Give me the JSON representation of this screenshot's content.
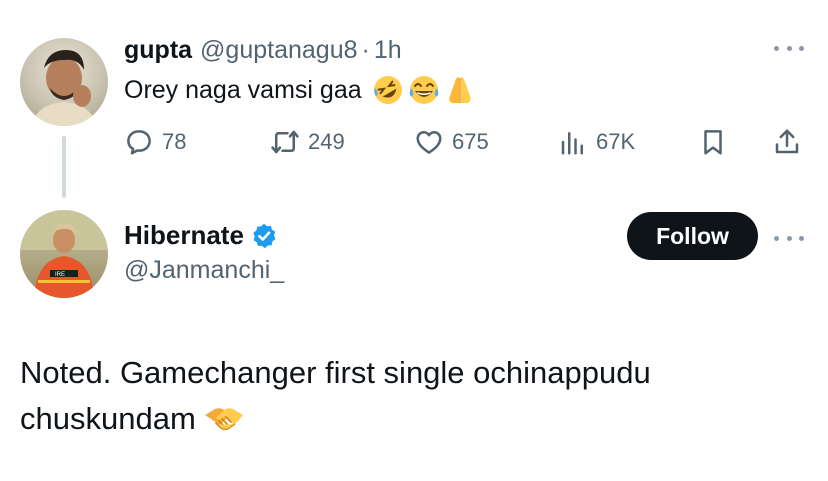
{
  "parent_tweet": {
    "display_name": "gupta",
    "handle": "@guptanagu8",
    "separator": "·",
    "time": "1h",
    "text": "Orey naga vamsi gaa",
    "emojis": [
      "rolling-on-floor-laughing-emoji",
      "tears-of-joy-emoji",
      "folded-hands-emoji"
    ],
    "stats": {
      "replies": "78",
      "reposts": "249",
      "likes": "675",
      "views": "67K"
    }
  },
  "reply_tweet": {
    "display_name": "Hibernate",
    "verified": true,
    "handle": "@Janmanchi_",
    "follow_label": "Follow",
    "text": "Noted. Gamechanger first single ochinappudu chuskundam",
    "emoji": "handshake-emoji"
  },
  "colors": {
    "text_primary": "#0f1419",
    "text_secondary": "#536471",
    "verified_blue": "#1d9bf0",
    "thread_line": "#cfd9de",
    "follow_bg": "#0f1419"
  }
}
